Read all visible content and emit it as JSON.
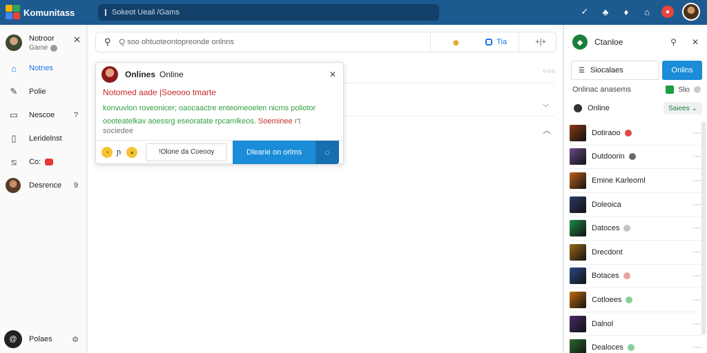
{
  "topbar": {
    "app_name": "Komunitass",
    "search_text": "Sokeot Ueail /Gams"
  },
  "sidebar": {
    "profile": {
      "name": "Notroor",
      "status": "Game"
    },
    "items": [
      {
        "label": "Notnes",
        "icon": "home-icon"
      },
      {
        "label": "Polie",
        "icon": "pencil-icon"
      },
      {
        "label": "Nescoe",
        "icon": "message-icon",
        "extra": "?"
      },
      {
        "label": "Leridelnst",
        "icon": "document-icon"
      },
      {
        "label": "Co:",
        "icon": "chart-icon"
      },
      {
        "label": "Desrence",
        "icon": "avatar-icon",
        "extra": "9"
      }
    ],
    "bottom": {
      "badge": "@",
      "label": "Polaes",
      "gear": "⚙"
    }
  },
  "main": {
    "search_placeholder": "Q soo ohtuoteontopreonde onlnns",
    "chip_label": "Tia",
    "tools_label": "+|+",
    "dots": "○○○"
  },
  "popup": {
    "title": "Onlines",
    "subtitle": "Online",
    "line1": "Notomed aade |Soeooo tmarte",
    "line2": "konvuvlon roveonicer; oaocaactre enteomeoelen nicms poliotor",
    "line3_green": "oooteatelkav aoessrg eseoratate rpcamlkeos.",
    "line3_red": "Soeminee",
    "line3_gray": "r't",
    "line4": "sociedee",
    "note": "ɲ",
    "cancel_label": "!Olone da Coeooy",
    "confirm_label": "Dlearie on orlms"
  },
  "rpanel": {
    "title": "Ctanloe",
    "toggle_label": "Siocalaes",
    "online_btn": "Onlins",
    "filter_label": "Onlinac anasems",
    "filter_box_label": "Slio",
    "status_label": "Online",
    "select_label": "Saiees",
    "friends": [
      {
        "name": "Dotiraoo",
        "badge": "#e04848",
        "thumb": "#8a3a1a"
      },
      {
        "name": "Dutdoorin",
        "badge": "#6a6a6a",
        "thumb": "#6b4a8a"
      },
      {
        "name": "Emine Karleoml",
        "badge": "",
        "thumb": "#c0601a"
      },
      {
        "name": "Doleoica",
        "badge": "",
        "thumb": "#2c3a66"
      },
      {
        "name": "Datoces",
        "badge": "#c4c4c4",
        "thumb": "#1f8a4a"
      },
      {
        "name": "Drecdont",
        "badge": "",
        "thumb": "#9a6a1a"
      },
      {
        "name": "Botaces",
        "badge": "#e8a0a0",
        "thumb": "#2a4a8a"
      },
      {
        "name": "Cotloees",
        "badge": "#8ccf9a",
        "thumb": "#c06a10"
      },
      {
        "name": "Dalnol",
        "badge": "",
        "thumb": "#4a2a6a"
      },
      {
        "name": "Dealoces",
        "badge": "#8ccf9a",
        "thumb": "#2a6a2a"
      }
    ]
  }
}
